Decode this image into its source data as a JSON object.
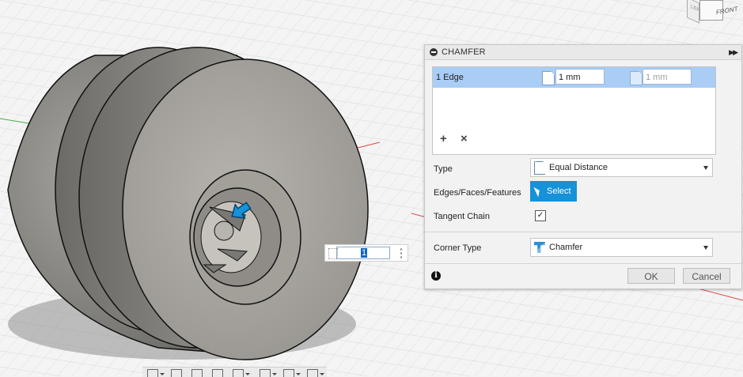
{
  "panel": {
    "title": "CHAMFER",
    "selection": {
      "edge_label": "1 Edge",
      "distance1": "1 mm",
      "distance2": "1 mm"
    },
    "type": {
      "label": "Type",
      "value": "Equal Distance"
    },
    "edges": {
      "label": "Edges/Faces/Features",
      "button": "Select"
    },
    "tangent": {
      "label": "Tangent Chain",
      "checked": "✓"
    },
    "corner": {
      "label": "Corner Type",
      "value": "Chamfer"
    },
    "ok": "OK",
    "cancel": "Cancel"
  },
  "hud": {
    "value": "1"
  },
  "viewcube": {
    "front": "FRONT",
    "left": "LEFT"
  },
  "colors": {
    "accent": "#1592d8",
    "selection_row": "#a9cdf5",
    "axis_red": "#d94b4b",
    "axis_green": "#45b045"
  }
}
